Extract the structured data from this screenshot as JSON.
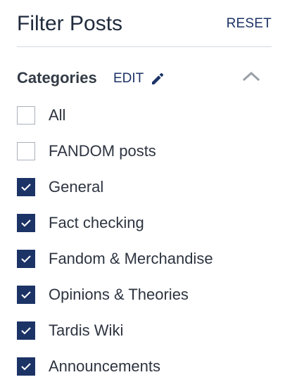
{
  "header": {
    "title": "Filter Posts",
    "reset_label": "RESET"
  },
  "categories": {
    "title": "Categories",
    "edit_label": "EDIT",
    "collapse_icon": "chevron-up-icon",
    "items": [
      {
        "label": "All",
        "checked": false
      },
      {
        "label": "FANDOM posts",
        "checked": false
      },
      {
        "label": "General",
        "checked": true
      },
      {
        "label": "Fact checking",
        "checked": true
      },
      {
        "label": "Fandom & Merchandise",
        "checked": true
      },
      {
        "label": "Opinions & Theories",
        "checked": true
      },
      {
        "label": "Tardis Wiki",
        "checked": true
      },
      {
        "label": "Announcements",
        "checked": true
      }
    ]
  },
  "colors": {
    "accent": "#1c3366",
    "text": "#2d3440",
    "divider": "#d5d9df",
    "chevron": "#9aa0a9"
  }
}
